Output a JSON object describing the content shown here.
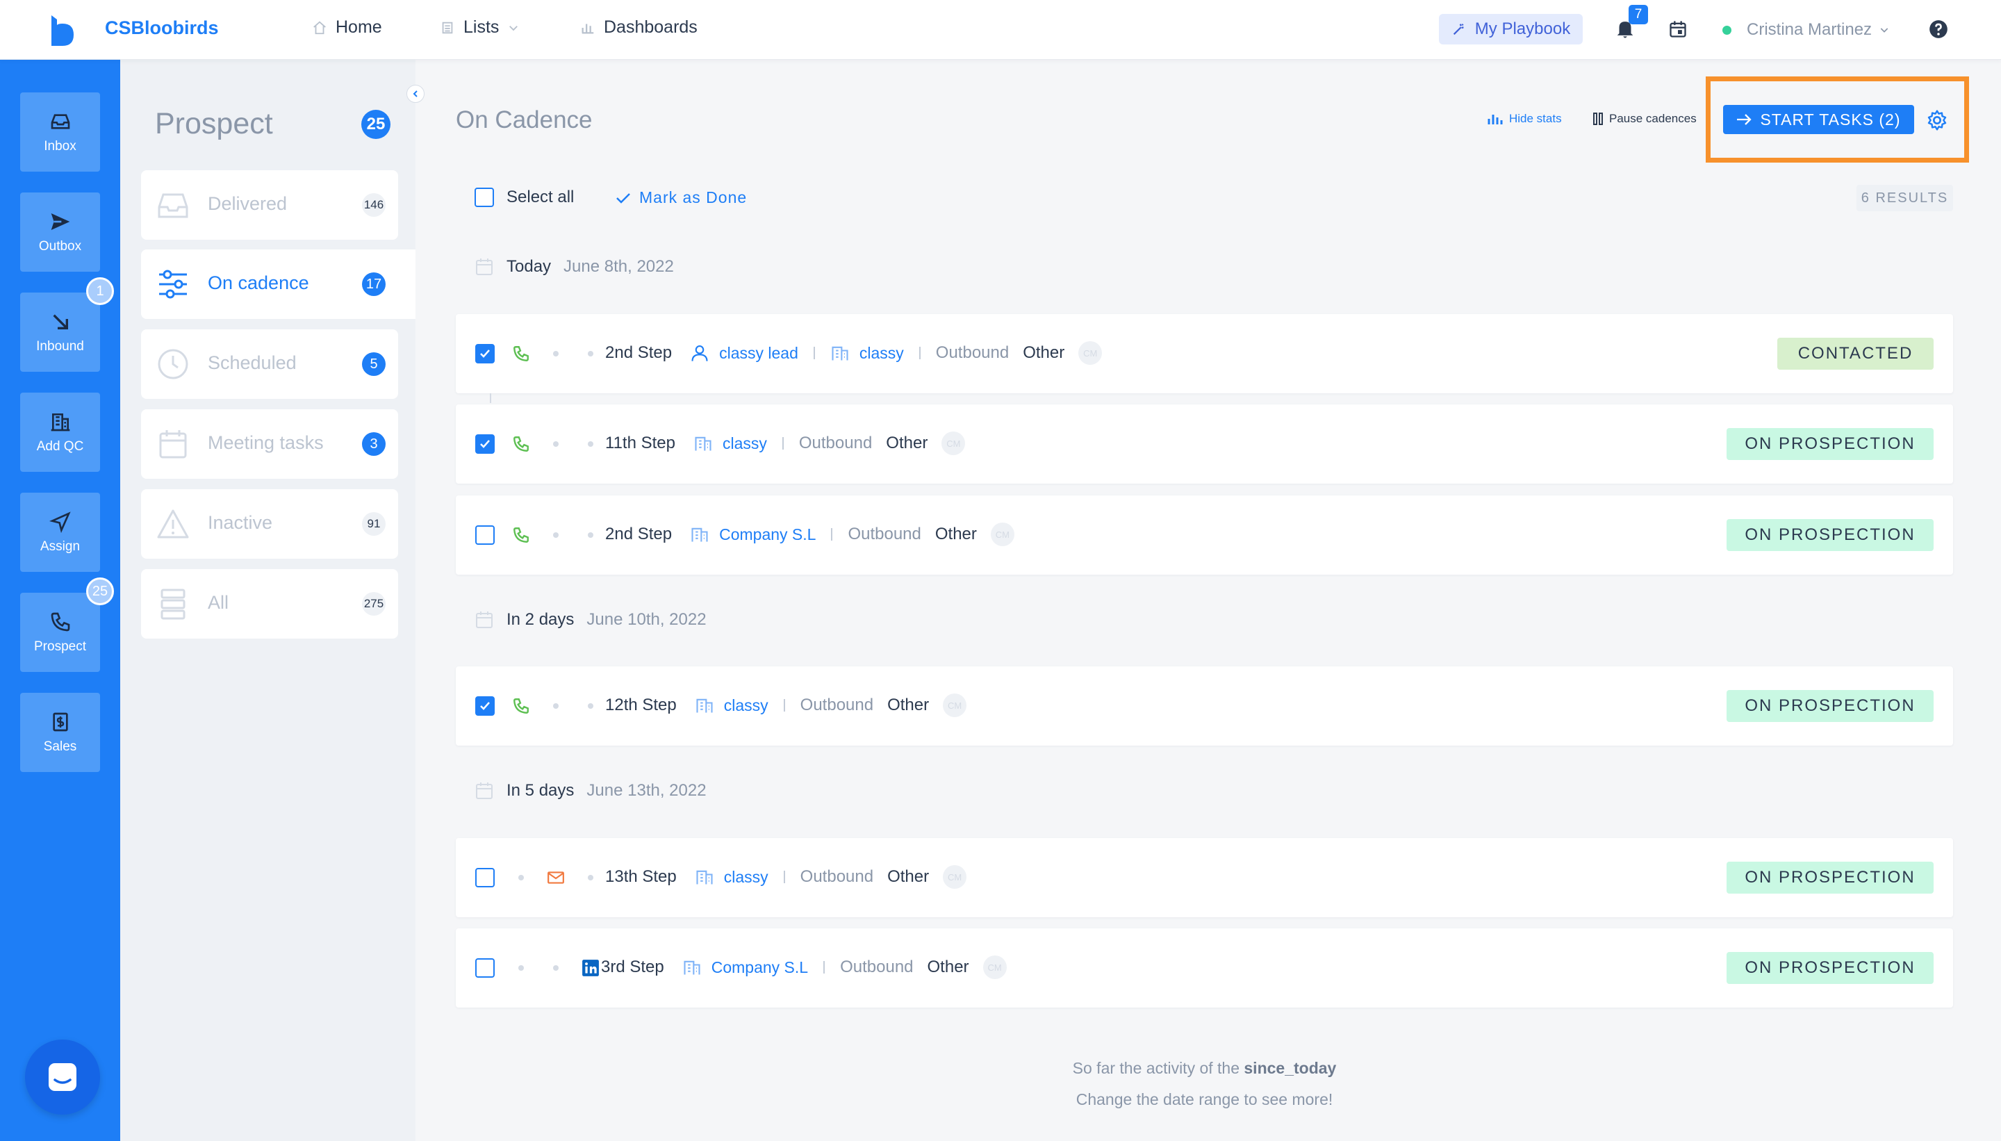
{
  "app": {
    "brand": "CSBloobirds",
    "accent": "#1e7ef6"
  },
  "nav": {
    "home": "Home",
    "lists": "Lists",
    "dashboards": "Dashboards"
  },
  "topbar": {
    "playbook": "My Playbook",
    "notifications": "7",
    "user": "Cristina Martinez",
    "help_icon": "question-icon"
  },
  "sidebar": {
    "items": [
      {
        "label": "Inbox",
        "icon": "inbox-icon"
      },
      {
        "label": "Outbox",
        "icon": "send-icon"
      },
      {
        "label": "Inbound",
        "icon": "arrow-down-right-icon",
        "badge": "1"
      },
      {
        "label": "Add QC",
        "icon": "building-icon"
      },
      {
        "label": "Assign",
        "icon": "navigation-icon"
      },
      {
        "label": "Prospect",
        "icon": "phone-icon",
        "badge": "25"
      },
      {
        "label": "Sales",
        "icon": "dollar-icon"
      }
    ]
  },
  "subsidebar": {
    "title": "Prospect",
    "count": "25",
    "items": [
      {
        "label": "Delivered",
        "count": "146"
      },
      {
        "label": "On cadence",
        "count": "17"
      },
      {
        "label": "Scheduled",
        "count": "5"
      },
      {
        "label": "Meeting tasks",
        "count": "3"
      },
      {
        "label": "Inactive",
        "count": "91"
      },
      {
        "label": "All",
        "count": "275"
      }
    ]
  },
  "main": {
    "title": "On Cadence",
    "hide_stats": "Hide stats",
    "pause_cadences": "Pause cadences",
    "start_tasks": "START TASKS (2)",
    "select_all": "Select all",
    "mark_done": "Mark as Done",
    "results": "6 RESULTS"
  },
  "groups": [
    {
      "day": "Today",
      "date": "June 8th, 2022"
    },
    {
      "day": "In 2 days",
      "date": "June 10th, 2022"
    },
    {
      "day": "In 5 days",
      "date": "June 13th, 2022"
    }
  ],
  "tasks": [
    {
      "step": "2nd Step",
      "lead": "classy lead",
      "company": "classy",
      "source": "Outbound",
      "other": "Other",
      "status": "CONTACTED"
    },
    {
      "step": "11th Step",
      "company": "classy",
      "source": "Outbound",
      "other": "Other",
      "status": "ON PROSPECTION"
    },
    {
      "step": "2nd Step",
      "company": "Company S.L",
      "source": "Outbound",
      "other": "Other",
      "status": "ON PROSPECTION"
    },
    {
      "step": "12th Step",
      "company": "classy",
      "source": "Outbound",
      "other": "Other",
      "status": "ON PROSPECTION"
    },
    {
      "step": "13th Step",
      "company": "classy",
      "source": "Outbound",
      "other": "Other",
      "status": "ON PROSPECTION"
    },
    {
      "step": "3rd Step",
      "company": "Company S.L",
      "source": "Outbound",
      "other": "Other",
      "status": "ON PROSPECTION"
    }
  ],
  "footer": {
    "line1_prefix": "So far the activity of the ",
    "line1_bold": "since_today",
    "line2": "Change the date range to see more!"
  }
}
